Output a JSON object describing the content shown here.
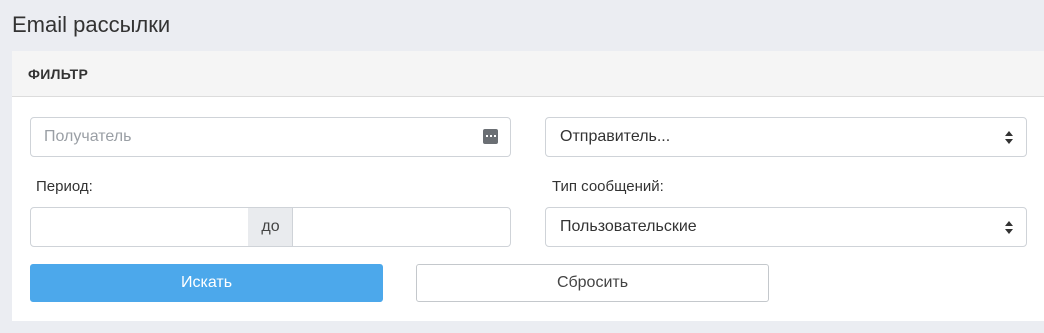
{
  "page": {
    "title": "Email рассылки"
  },
  "filter": {
    "heading": "ФИЛЬТР",
    "recipient": {
      "placeholder": "Получатель",
      "value": ""
    },
    "sender": {
      "selected": "Отправитель..."
    },
    "period": {
      "label": "Период:",
      "from_value": "",
      "separator": "до",
      "to_value": ""
    },
    "message_type": {
      "label": "Тип сообщений:",
      "selected": "Пользовательские"
    },
    "search_label": "Искать",
    "reset_label": "Сбросить"
  },
  "colors": {
    "primary": "#4ca8eb",
    "page_bg": "#ebedf2",
    "panel_heading_bg": "#f5f5f5"
  },
  "icons": {
    "recipient_field": "ellipsis-box-icon",
    "select_caret": "sort-caret-icon"
  }
}
